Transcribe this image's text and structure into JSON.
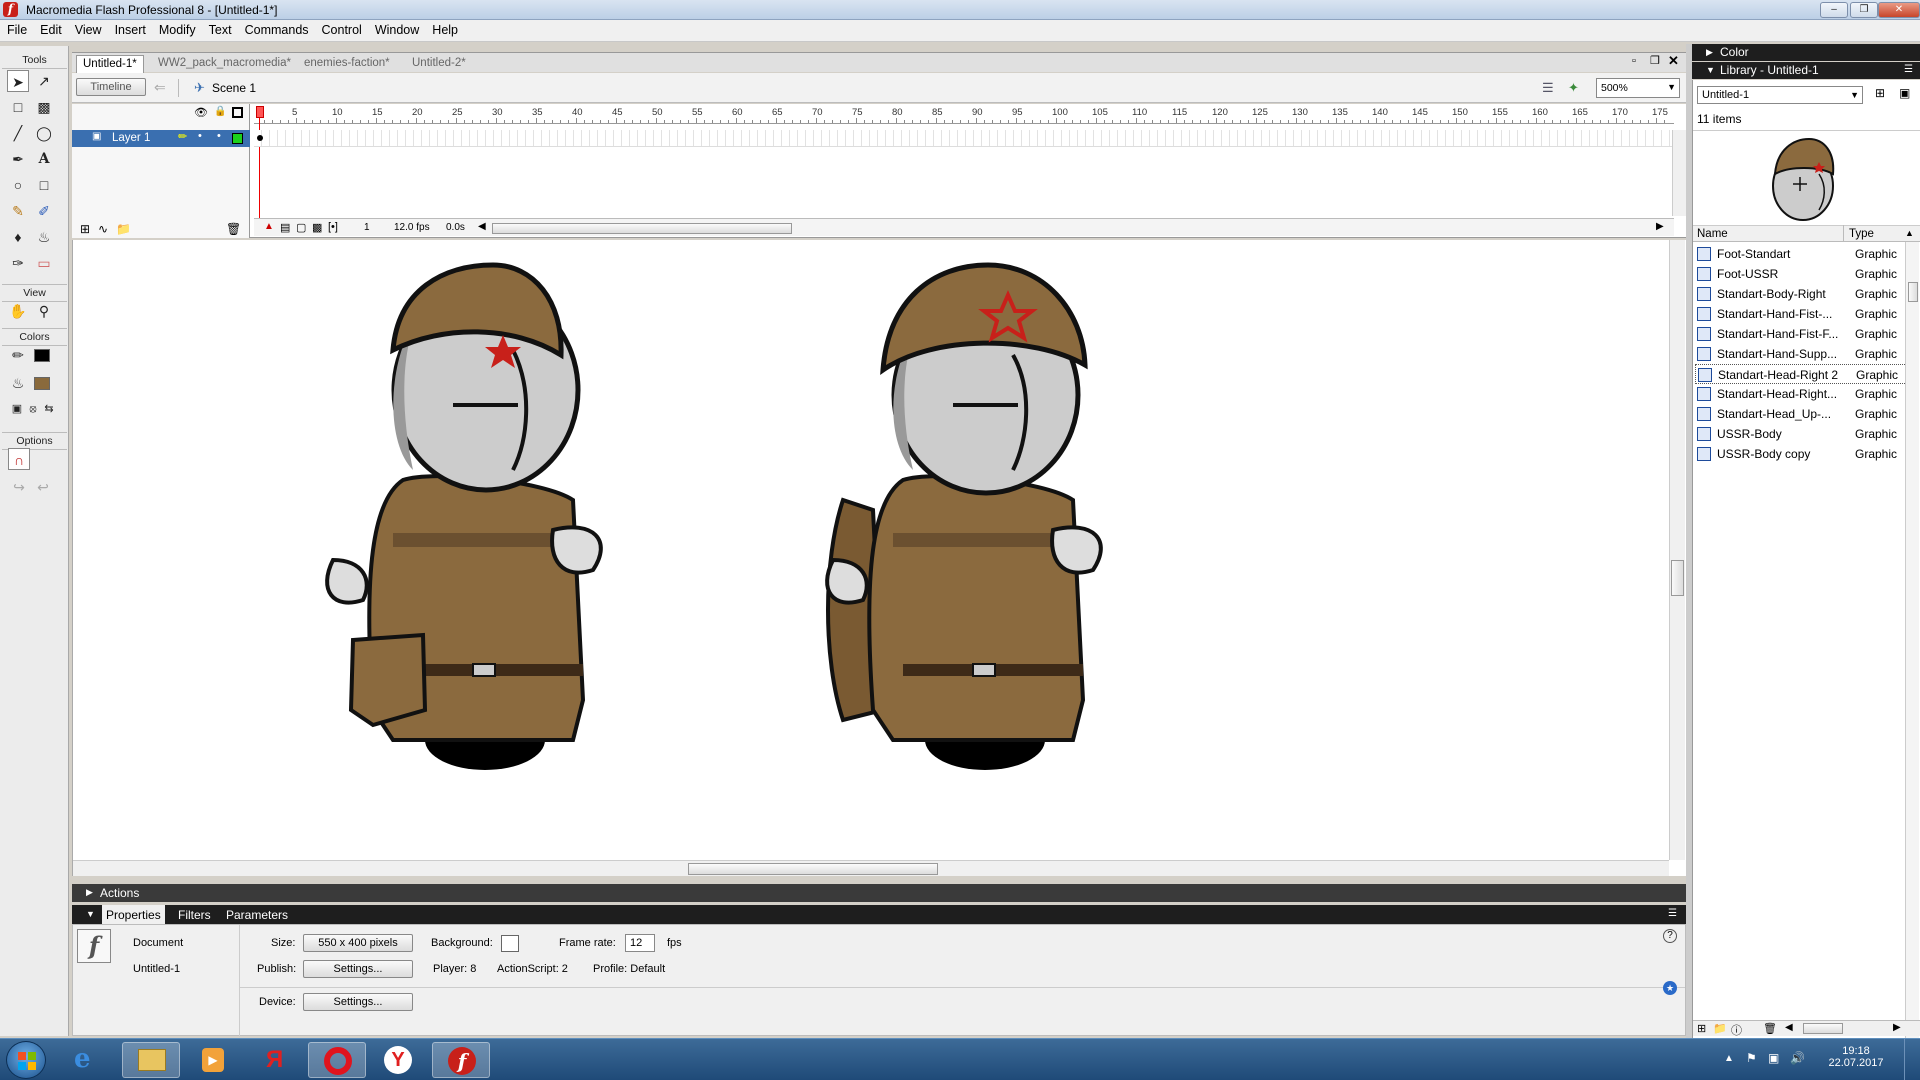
{
  "window": {
    "title": "Macromedia Flash Professional 8 - [Untitled-1*]"
  },
  "menu": [
    "File",
    "Edit",
    "View",
    "Insert",
    "Modify",
    "Text",
    "Commands",
    "Control",
    "Window",
    "Help"
  ],
  "tools": {
    "header": "Tools",
    "view": "View",
    "colors": "Colors",
    "options": "Options"
  },
  "doc_tabs": [
    {
      "label": "Untitled-1*",
      "active": true
    },
    {
      "label": "WW2_pack_macromedia*",
      "active": false
    },
    {
      "label": "enemies-faction*",
      "active": false
    },
    {
      "label": "Untitled-2*",
      "active": false
    }
  ],
  "timeline": {
    "toggle_label": "Timeline",
    "scene": "Scene 1",
    "zoom": "500%",
    "layer": "Layer 1",
    "ruler": [
      "5",
      "10",
      "15",
      "20",
      "25",
      "30",
      "35",
      "40",
      "45",
      "50",
      "55",
      "60",
      "65",
      "70",
      "75",
      "80",
      "85",
      "90",
      "95",
      "100",
      "105",
      "110",
      "115",
      "120",
      "125",
      "130",
      "135",
      "140",
      "145",
      "150",
      "155",
      "160",
      "165",
      "170",
      "175"
    ],
    "frame": "1",
    "fps": "12.0 fps",
    "time": "0.0s"
  },
  "panels": {
    "actions": "Actions",
    "tabs": [
      "Properties",
      "Filters",
      "Parameters"
    ]
  },
  "properties": {
    "doc_label": "Document",
    "doc_name": "Untitled-1",
    "size_label": "Size:",
    "size_value": "550 x 400 pixels",
    "background_label": "Background:",
    "framerate_label": "Frame rate:",
    "framerate_value": "12",
    "fps_unit": "fps",
    "publish_label": "Publish:",
    "settings_label": "Settings...",
    "player": "Player: 8",
    "actionscript": "ActionScript: 2",
    "profile": "Profile: Default",
    "device_label": "Device:"
  },
  "right_panels": {
    "color": "Color",
    "library_title": "Library - Untitled-1",
    "library_select": "Untitled-1",
    "item_count": "11 items",
    "col_name": "Name",
    "col_type": "Type",
    "items": [
      {
        "name": "Foot-Standart",
        "type": "Graphic"
      },
      {
        "name": "Foot-USSR",
        "type": "Graphic"
      },
      {
        "name": "Standart-Body-Right",
        "type": "Graphic"
      },
      {
        "name": "Standart-Hand-Fist-...",
        "type": "Graphic"
      },
      {
        "name": "Standart-Hand-Fist-F...",
        "type": "Graphic"
      },
      {
        "name": "Standart-Hand-Supp...",
        "type": "Graphic"
      },
      {
        "name": "Standart-Head-Right 2",
        "type": "Graphic",
        "selected": true
      },
      {
        "name": "Standart-Head-Right...",
        "type": "Graphic"
      },
      {
        "name": "Standart-Head_Up-...",
        "type": "Graphic"
      },
      {
        "name": "USSR-Body",
        "type": "Graphic"
      },
      {
        "name": "USSR-Body copy",
        "type": "Graphic"
      }
    ]
  },
  "taskbar": {
    "time": "19:18",
    "date": "22.07.2017"
  },
  "colors": {
    "stroke": "#000000",
    "fill": "#8a6a3c",
    "accent": "#c8201a"
  }
}
